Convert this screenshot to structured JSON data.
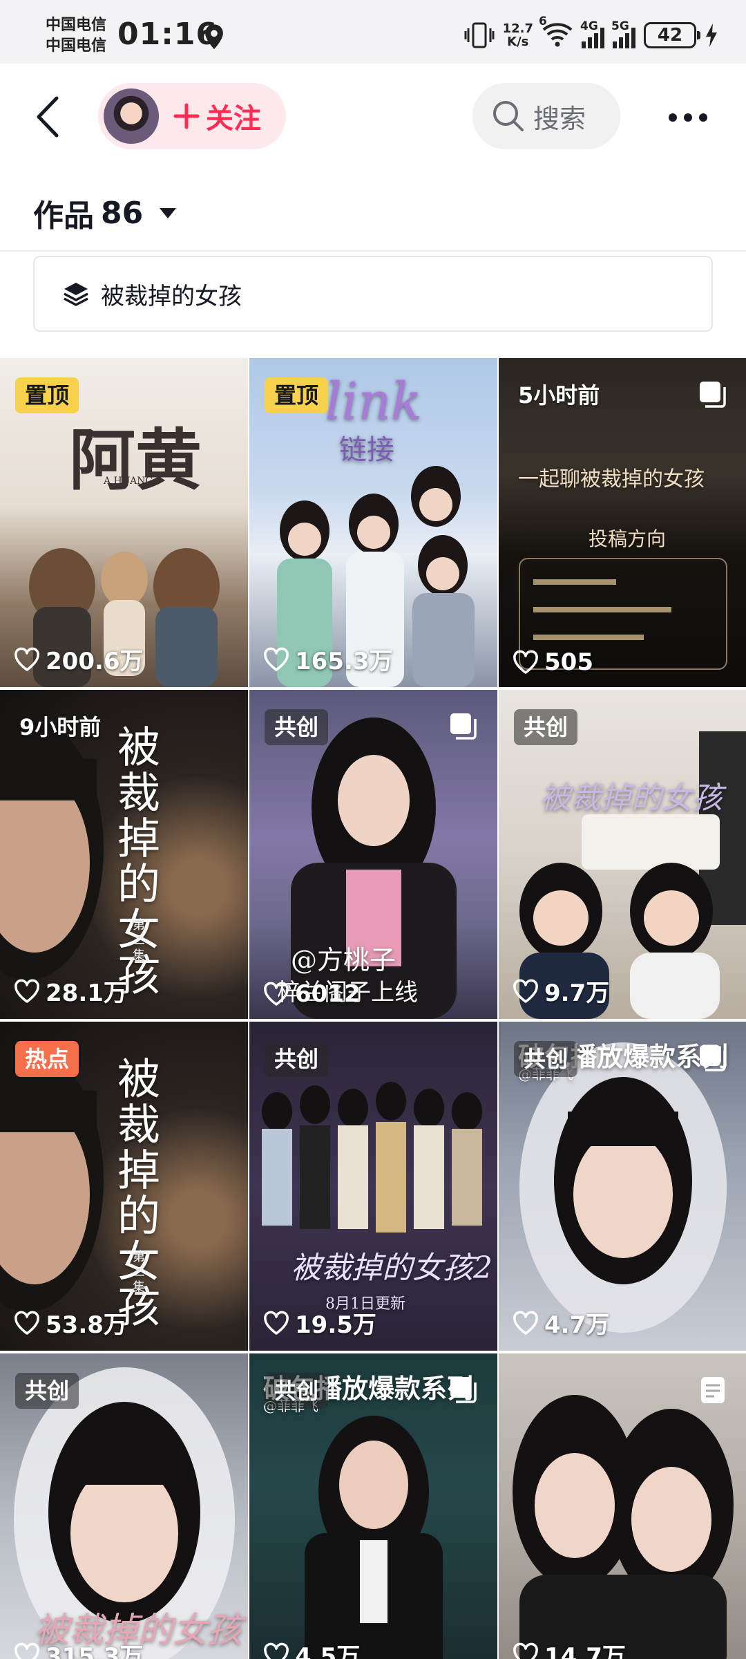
{
  "status_bar": {
    "carrier_1": "中国电信",
    "carrier_2": "中国电信",
    "time": "01:16",
    "speed_value": "12.7",
    "speed_unit": "K/s",
    "wifi_badge": "6",
    "net_1": "4G",
    "net_2": "5G",
    "battery": "42"
  },
  "header": {
    "follow_label": "关注",
    "search_label": "搜索"
  },
  "works": {
    "label": "作品",
    "count": "86"
  },
  "collection": {
    "label": "被裁掉的女孩"
  },
  "videos": [
    {
      "badge": "置顶",
      "likes": "200.6万",
      "title": "阿黄",
      "subtitle": "A HUANG"
    },
    {
      "badge": "置顶",
      "likes": "165.3万",
      "title": "链接",
      "subtitle": "link"
    },
    {
      "badge": "5小时前",
      "likes": "505",
      "title": "一起聊被裁掉的女孩",
      "subtitle": "投稿方向"
    },
    {
      "badge": "9小时前",
      "likes": "28.1万",
      "title": "被裁掉的女孩",
      "subtitle": "第二集"
    },
    {
      "badge": "共创",
      "likes": "6012",
      "title": "@方桃子",
      "subtitle": "梓兰阁子上线"
    },
    {
      "badge": "共创",
      "likes": "9.7万",
      "title": "被裁掉的女孩",
      "subtitle": ""
    },
    {
      "badge": "热点",
      "likes": "53.8万",
      "title": "被裁掉的女孩",
      "subtitle": "第二集"
    },
    {
      "badge": "共创",
      "likes": "19.5万",
      "title": "被裁掉的女孩2",
      "subtitle": "8月1日更新"
    },
    {
      "badge": "共创",
      "likes": "4.7万",
      "title": "破包播放爆款系列",
      "subtitle": "@菲菲飞"
    },
    {
      "badge": "共创",
      "likes": "315.3万",
      "title": "被裁掉的女孩",
      "subtitle": ""
    },
    {
      "badge": "共创",
      "likes": "4.5万",
      "title": "破包播放爆款系列",
      "subtitle": "@菲菲飞"
    },
    {
      "badge": "",
      "likes": "14.7万",
      "title": "",
      "subtitle": ""
    }
  ],
  "colors": {
    "accent": "#fe2c55",
    "pinned_badge": "#f7d14b",
    "hot_badge": "#f56f4a"
  }
}
